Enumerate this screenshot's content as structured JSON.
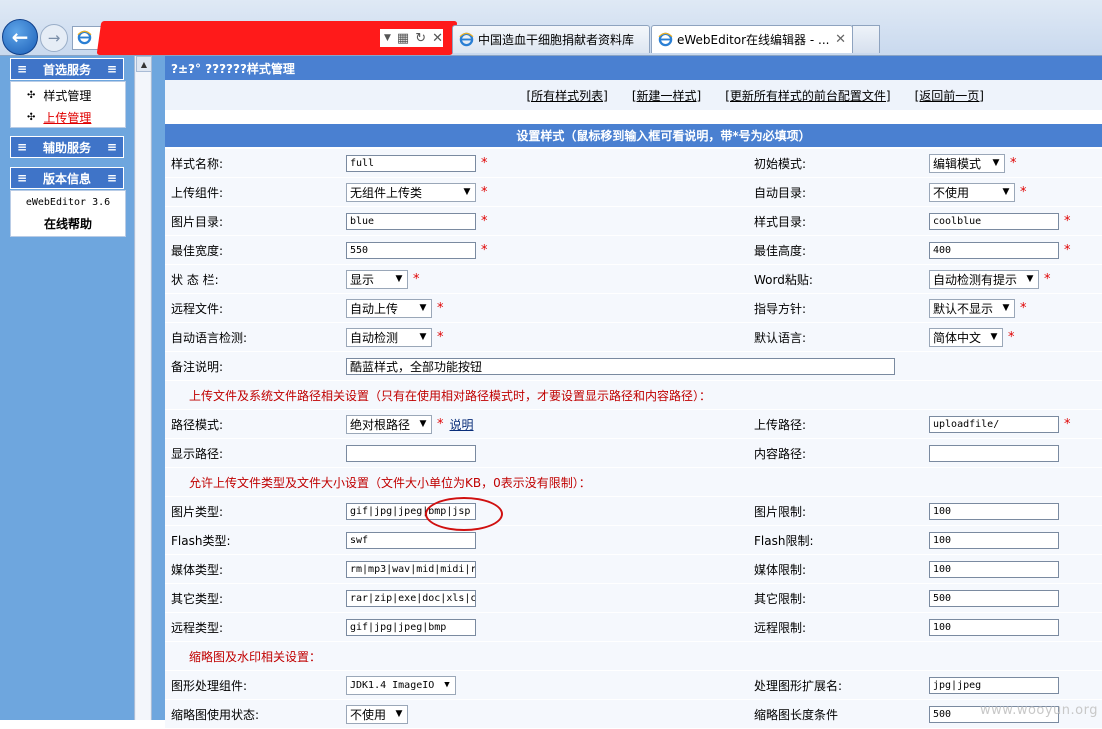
{
  "browser": {
    "tabs": [
      {
        "label": "中国造血干细胞捐献者资料库"
      },
      {
        "label": "eWebEditor在线编辑器 - ..."
      }
    ]
  },
  "sidebar": {
    "sections": [
      {
        "title": "首选服务",
        "items": [
          "样式管理",
          "上传管理"
        ]
      },
      {
        "title": "辅助服务"
      },
      {
        "title": "版本信息",
        "lines": [
          "eWebEditor 3.6",
          "在线帮助"
        ]
      }
    ]
  },
  "main": {
    "title": "?±?° ??????样式管理",
    "nav": [
      "[所有样式列表]",
      "[新建一样式]",
      "[更新所有样式的前台配置文件]",
      "[返回前一页]"
    ],
    "form_title": "设置样式（鼠标移到输入框可看说明，带*号为必填项）",
    "rows": [
      {
        "l1": "样式名称:",
        "v1": "full",
        "l2": "初始模式:",
        "v2": "编辑模式"
      },
      {
        "l1": "上传组件:",
        "v1": "无组件上传类",
        "l2": "自动目录:",
        "v2": "不使用"
      },
      {
        "l1": "图片目录:",
        "v1": "blue",
        "l2": "样式目录:",
        "v2": "coolblue"
      },
      {
        "l1": "最佳宽度:",
        "v1": "550",
        "l2": "最佳高度:",
        "v2": "400"
      },
      {
        "l1": "状 态 栏:",
        "v1": "显示",
        "l2": "Word粘贴:",
        "v2": "自动检测有提示"
      },
      {
        "l1": "远程文件:",
        "v1": "自动上传",
        "l2": "指导方针:",
        "v2": "默认不显示"
      },
      {
        "l1": "自动语言检测:",
        "v1": "自动检测",
        "l2": "默认语言:",
        "v2": "简体中文"
      },
      {
        "l1": "备注说明:",
        "v1": "酷蓝样式，全部功能按钮"
      },
      {
        "section": "上传文件及系统文件路径相关设置（只有在使用相对路径模式时，才要设置显示路径和内容路径）："
      },
      {
        "l1": "路径模式:",
        "v1": "绝对根路径",
        "hint": "说明",
        "l2": "上传路径:",
        "v2": "uploadfile/"
      },
      {
        "l1": "显示路径:",
        "v1": "",
        "l2": "内容路径:",
        "v2": ""
      },
      {
        "section": "允许上传文件类型及文件大小设置（文件大小单位为KB，0表示没有限制）："
      },
      {
        "l1": "图片类型:",
        "v1": "gif|jpg|jpeg|bmp|jsp",
        "l2": "图片限制:",
        "v2": "100"
      },
      {
        "l1": "Flash类型:",
        "v1": "swf",
        "l2": "Flash限制:",
        "v2": "100"
      },
      {
        "l1": "媒体类型:",
        "v1": "rm|mp3|wav|mid|midi|r",
        "l2": "媒体限制:",
        "v2": "100"
      },
      {
        "l1": "其它类型:",
        "v1": "rar|zip|exe|doc|xls|c",
        "l2": "其它限制:",
        "v2": "500"
      },
      {
        "l1": "远程类型:",
        "v1": "gif|jpg|jpeg|bmp",
        "l2": "远程限制:",
        "v2": "100"
      },
      {
        "section": "缩略图及水印相关设置："
      },
      {
        "l1": "图形处理组件:",
        "v1": "JDK1.4 ImageIO",
        "l2": "处理图形扩展名:",
        "v2": "jpg|jpeg"
      },
      {
        "l1": "缩略图使用状态:",
        "v1": "不使用",
        "l2": "缩略图长度条件",
        "v2": "500"
      }
    ]
  },
  "watermark": "www.wooyun.org",
  "colors": {
    "header_blue": "#4a80d1",
    "sidebar_blue": "#6ea6de",
    "required_red": "#e00000"
  }
}
